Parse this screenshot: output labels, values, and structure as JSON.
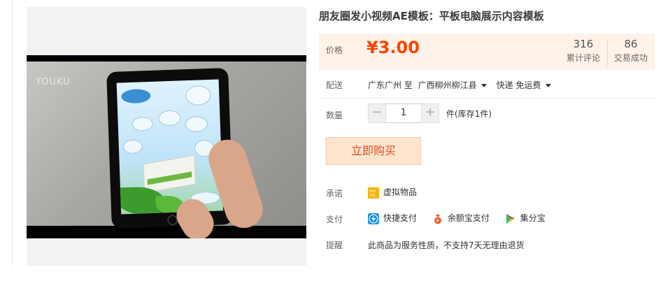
{
  "product": {
    "title": "朋友圈发小视频AE模板：平板电脑展示内容模板",
    "video_watermark": "YOUKU"
  },
  "price": {
    "label": "价格",
    "value": "¥3.00",
    "reviews_count": "316",
    "reviews_label": "累计评论",
    "deals_count": "86",
    "deals_label": "交易成功"
  },
  "shipping": {
    "label": "配送",
    "from": "广东广州 至",
    "to": "广西柳州柳江县",
    "method": "快递 免运费"
  },
  "quantity": {
    "label": "数量",
    "minus": "−",
    "value": "1",
    "plus": "+",
    "stock": "件(库存1件)"
  },
  "buy_button": "立即购买",
  "promise": {
    "label": "承诺",
    "item": "虚拟物品"
  },
  "payment": {
    "label": "支付",
    "items": [
      "快捷支付",
      "余额宝支付",
      "集分宝"
    ]
  },
  "notice": {
    "label": "提醒",
    "text": "此商品为服务性质，不支持7天无理由退货"
  },
  "colors": {
    "price_red": "#ff4400",
    "price_bg": "#fff2e8",
    "buy_bg": "#ffe4d0",
    "buy_text": "#e5511d"
  }
}
